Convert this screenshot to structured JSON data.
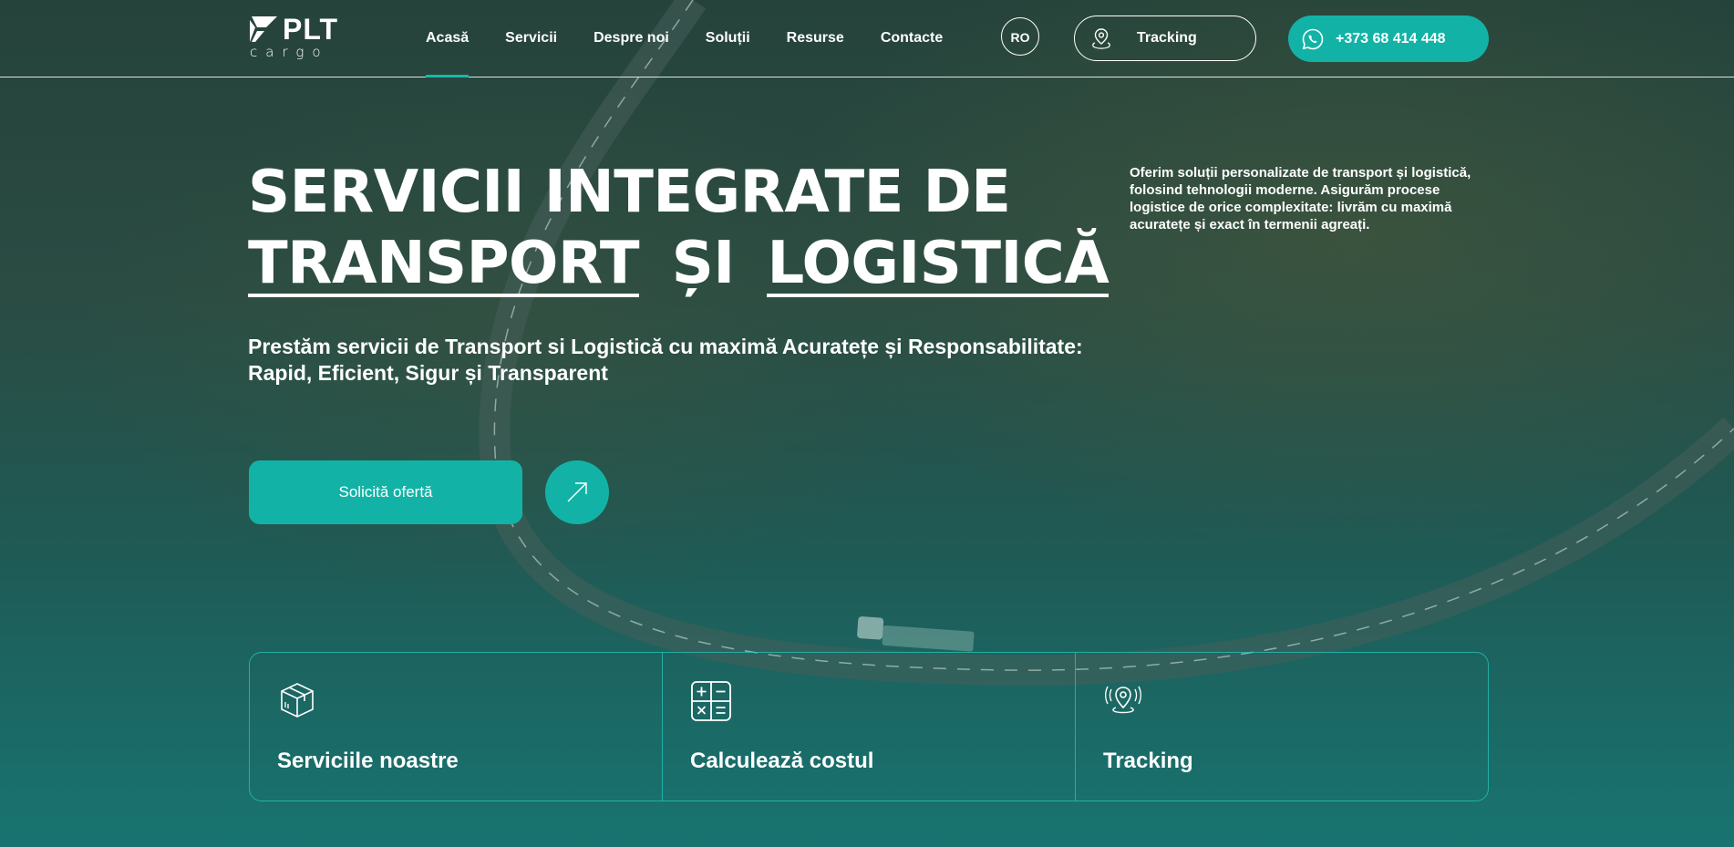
{
  "brand": {
    "logo_text": "PLT",
    "logo_sub": "cargo",
    "accent_color": "#12b3a6"
  },
  "nav": {
    "items": [
      {
        "label": "Acasă",
        "active": true
      },
      {
        "label": "Servicii",
        "active": false
      },
      {
        "label": "Despre noi",
        "active": false
      },
      {
        "label": "Soluții",
        "active": false
      },
      {
        "label": "Resurse",
        "active": false
      },
      {
        "label": "Contacte",
        "active": false
      }
    ]
  },
  "header": {
    "language": "RO",
    "tracking_label": "Tracking",
    "tracking_icon": "location-pin-icon",
    "phone_label": "+373 68 414 448",
    "phone_icon": "whatsapp-icon"
  },
  "hero": {
    "title_line1": "SERVICII INTEGRATE DE",
    "title_word_transport": "TRANSPORT",
    "title_word_si": "ȘI",
    "title_word_logistica": "LOGISTICĂ",
    "subtitle": "Prestăm servicii de Transport si Logistică cu maximă Acuratețe și Responsabilitate: Rapid, Eficient, Sigur și Transparent",
    "description": "Oferim soluții personalizate de transport și logistică, folosind tehnologii moderne. Asigurăm procese logistice de orice complexitate: livrăm cu maximă acuratețe și exact în termenii agreați.",
    "cta_label": "Solicită ofertă",
    "cta_arrow_icon": "arrow-up-right-icon"
  },
  "cards": [
    {
      "label": "Serviciile noastre",
      "icon": "package-box-icon"
    },
    {
      "label": "Calculează costul",
      "icon": "calculator-icon"
    },
    {
      "label": "Tracking",
      "icon": "location-pin-icon"
    }
  ]
}
